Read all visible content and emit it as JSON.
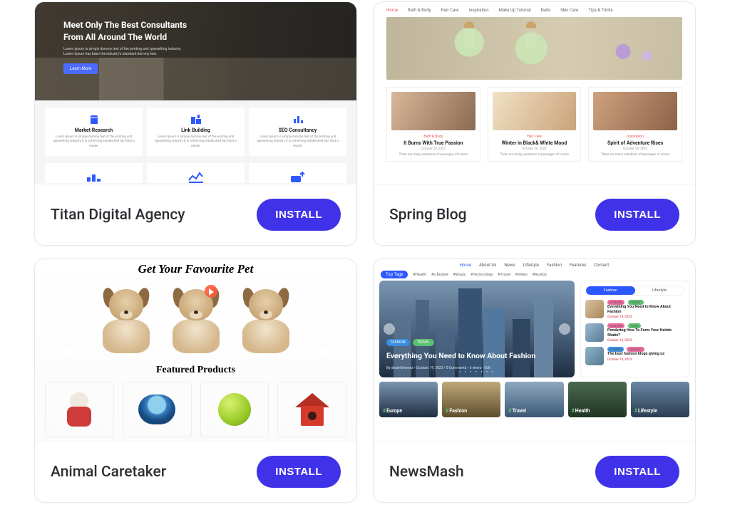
{
  "common": {
    "install": "INSTALL"
  },
  "cards": {
    "titan": {
      "title": "Titan Digital Agency",
      "hero_title_l1": "Meet Only The Best Consultants",
      "hero_title_l2": "From All Around The World",
      "hero_sub": "Lorem ipsum is simply dummy text of the printing and typesetting industry. Lorem Ipsum has been the industry's standard dummy text.",
      "cta": "Learn More",
      "features": [
        {
          "label": "Market Research"
        },
        {
          "label": "Link Building"
        },
        {
          "label": "SEO Consultancy"
        }
      ],
      "feature_desc": "Lorem Ipsum is simply dummy text of the printing and typesetting industry It is a the long established fact that a reader"
    },
    "spring": {
      "title": "Spring Blog",
      "nav": [
        "Home",
        "Bath & Body",
        "Hair Care",
        "Inspiration",
        "Make Up Tutorial",
        "Nails",
        "Skin Care",
        "Tips & Tricks"
      ],
      "posts": [
        {
          "cat": "Bath & Body",
          "title": "It Burns With True Passion",
          "date": "October 20, 2023"
        },
        {
          "cat": "Hair Care",
          "title": "Winter in Black& White Mood",
          "date": "October 20, 2023"
        },
        {
          "cat": "Inspiration",
          "title": "Spirit of Adventure Rises",
          "date": "October 20, 2023"
        }
      ],
      "excerpt": "There are many variations of passages of Lorem"
    },
    "animal": {
      "title": "Animal Caretaker",
      "hero_title": "Get Your Favourite Pet",
      "watch": "Watch Video",
      "subtitle": "Featured Products"
    },
    "newsmash": {
      "title": "NewsMash",
      "nav": [
        "Home",
        "About Us",
        "News",
        "Lifestyle",
        "Fashion",
        "Features",
        "Contact"
      ],
      "toptags_label": "Top Tags",
      "toptags": [
        "#Health",
        "#Lifestyle",
        "#Music",
        "#Technology",
        "#Travel",
        "#Video",
        "#Audios"
      ],
      "hero": {
        "chips": [
          "FASHION",
          "TRAVEL"
        ],
        "headline": "Everything You Need to Know About Fashion",
        "meta": "By desertthemes   •   October 19, 2023   •   0 Comments   •   6 views   •   Edit"
      },
      "side": {
        "seg": [
          "Fashion",
          "Lifestyle"
        ],
        "items": [
          {
            "chips": [
              "FASHION",
              "TRAVEL"
            ],
            "title": "Everything You Need to Know About Fashion",
            "date": "October 19, 2023"
          },
          {
            "chips": [
              "FASHION",
              "FOOD"
            ],
            "title": "Pondering How To Form Your Hairdo Shake?",
            "date": "October 19, 2023"
          },
          {
            "chips": [
              "EUROPE",
              "FASHION"
            ],
            "title": "The best fashion blogs giving us",
            "date": "October 19, 2023"
          }
        ]
      },
      "cats": [
        "Europe",
        "Fashion",
        "Travel",
        "Health",
        "Lifestyle"
      ]
    }
  }
}
